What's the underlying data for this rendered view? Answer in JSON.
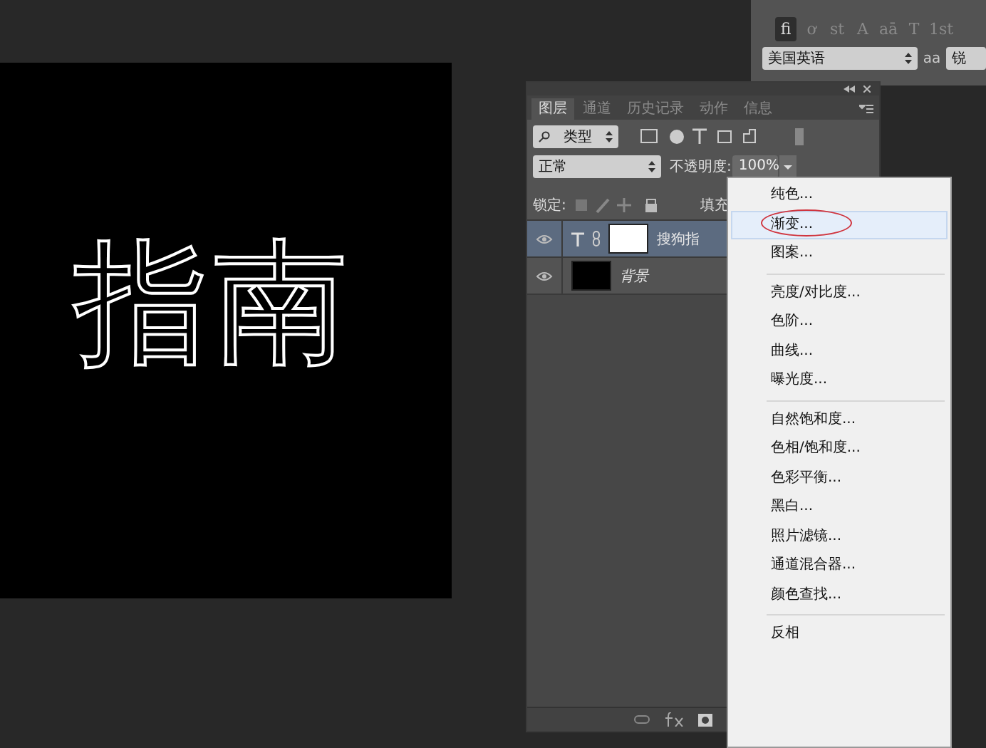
{
  "canvas": {
    "text": "指南"
  },
  "character_panel": {
    "glyph_buttons": [
      {
        "label": "fi",
        "selected": true
      },
      {
        "label": "ơ",
        "selected": false
      },
      {
        "label": "st",
        "selected": false
      },
      {
        "label": "A",
        "selected": false
      },
      {
        "label": "aā",
        "selected": false
      },
      {
        "label": "T",
        "selected": false
      },
      {
        "label": "1st",
        "selected": false
      }
    ],
    "language": "美国英语",
    "antialias_icon": "aa",
    "antialias": "锐"
  },
  "layers_panel": {
    "tabs": [
      {
        "label": "图层",
        "selected": true
      },
      {
        "label": "通道",
        "selected": false
      },
      {
        "label": "历史记录",
        "selected": false
      },
      {
        "label": "动作",
        "selected": false
      },
      {
        "label": "信息",
        "selected": false
      }
    ],
    "filter": "类型",
    "blend_mode": "正常",
    "opacity_label": "不透明度:",
    "opacity": "100%",
    "lock_label": "锁定:",
    "fill_label": "填充",
    "layers": [
      {
        "kind": "text",
        "name": "搜狗指",
        "selected": true,
        "visible": true
      },
      {
        "kind": "image",
        "name": "背景",
        "selected": false,
        "visible": true
      }
    ]
  },
  "menu": {
    "items": [
      {
        "kind": "item",
        "label": "纯色...",
        "highlighted": false,
        "circled": false
      },
      {
        "kind": "item",
        "label": "渐变...",
        "highlighted": true,
        "circled": true
      },
      {
        "kind": "item",
        "label": "图案...",
        "highlighted": false,
        "circled": false
      },
      {
        "kind": "separator"
      },
      {
        "kind": "item",
        "label": "亮度/对比度...",
        "highlighted": false,
        "circled": false
      },
      {
        "kind": "item",
        "label": "色阶...",
        "highlighted": false,
        "circled": false
      },
      {
        "kind": "item",
        "label": "曲线...",
        "highlighted": false,
        "circled": false
      },
      {
        "kind": "item",
        "label": "曝光度...",
        "highlighted": false,
        "circled": false
      },
      {
        "kind": "separator"
      },
      {
        "kind": "item",
        "label": "自然饱和度...",
        "highlighted": false,
        "circled": false
      },
      {
        "kind": "item",
        "label": "色相/饱和度...",
        "highlighted": false,
        "circled": false
      },
      {
        "kind": "item",
        "label": "色彩平衡...",
        "highlighted": false,
        "circled": false
      },
      {
        "kind": "item",
        "label": "黑白...",
        "highlighted": false,
        "circled": false
      },
      {
        "kind": "item",
        "label": "照片滤镜...",
        "highlighted": false,
        "circled": false
      },
      {
        "kind": "item",
        "label": "通道混合器...",
        "highlighted": false,
        "circled": false
      },
      {
        "kind": "item",
        "label": "颜色查找...",
        "highlighted": false,
        "circled": false
      },
      {
        "kind": "separator"
      },
      {
        "kind": "item",
        "label": "反相",
        "highlighted": false,
        "circled": false
      }
    ]
  }
}
